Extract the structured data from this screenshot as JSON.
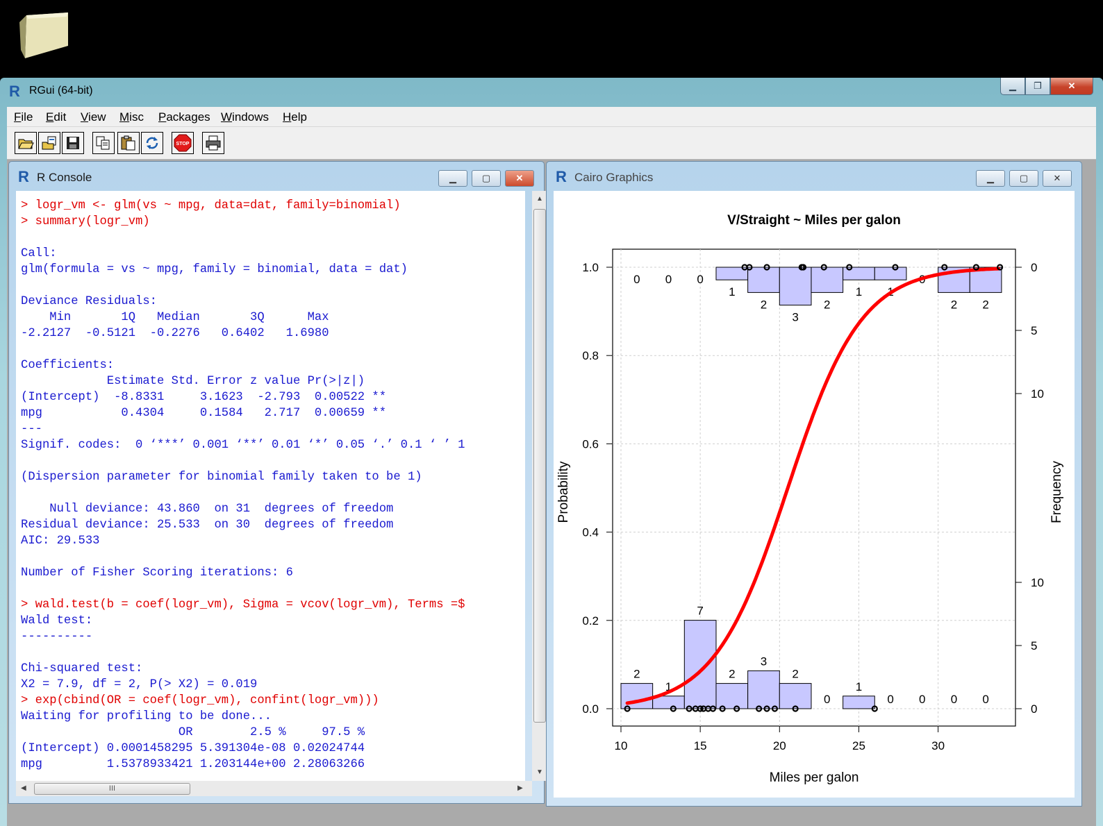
{
  "app": {
    "title": "RGui (64-bit)"
  },
  "menu": [
    {
      "label": "File",
      "key": "F",
      "rest": "ile"
    },
    {
      "label": "Edit",
      "key": "E",
      "rest": "dit"
    },
    {
      "label": "View",
      "key": "V",
      "rest": "iew"
    },
    {
      "label": "Misc",
      "key": "M",
      "rest": "isc"
    },
    {
      "label": "Packages",
      "key": "P",
      "rest": "ackages"
    },
    {
      "label": "Windows",
      "key": "W",
      "rest": "indows"
    },
    {
      "label": "Help",
      "key": "H",
      "rest": "elp"
    }
  ],
  "toolbar": [
    "open-script-icon",
    "load-workspace-icon",
    "save-workspace-icon",
    "copy-icon",
    "paste-icon",
    "refresh-icon",
    "stop-icon",
    "print-icon"
  ],
  "console": {
    "title": "R Console",
    "lines": [
      {
        "t": "> logr_vm <- glm(vs ~ mpg, data=dat, family=binomial)",
        "in": true
      },
      {
        "t": "> summary(logr_vm)",
        "in": true
      },
      {
        "t": "",
        "in": false
      },
      {
        "t": "Call:",
        "in": false
      },
      {
        "t": "glm(formula = vs ~ mpg, family = binomial, data = dat)",
        "in": false
      },
      {
        "t": "",
        "in": false
      },
      {
        "t": "Deviance Residuals:",
        "in": false
      },
      {
        "t": "    Min       1Q   Median       3Q      Max",
        "in": false
      },
      {
        "t": "-2.2127  -0.5121  -0.2276   0.6402   1.6980",
        "in": false
      },
      {
        "t": "",
        "in": false
      },
      {
        "t": "Coefficients:",
        "in": false
      },
      {
        "t": "            Estimate Std. Error z value Pr(>|z|)",
        "in": false
      },
      {
        "t": "(Intercept)  -8.8331     3.1623  -2.793  0.00522 **",
        "in": false
      },
      {
        "t": "mpg           0.4304     0.1584   2.717  0.00659 **",
        "in": false
      },
      {
        "t": "---",
        "in": false
      },
      {
        "t": "Signif. codes:  0 ‘***’ 0.001 ‘**’ 0.01 ‘*’ 0.05 ‘.’ 0.1 ‘ ’ 1",
        "in": false
      },
      {
        "t": "",
        "in": false
      },
      {
        "t": "(Dispersion parameter for binomial family taken to be 1)",
        "in": false
      },
      {
        "t": "",
        "in": false
      },
      {
        "t": "    Null deviance: 43.860  on 31  degrees of freedom",
        "in": false
      },
      {
        "t": "Residual deviance: 25.533  on 30  degrees of freedom",
        "in": false
      },
      {
        "t": "AIC: 29.533",
        "in": false
      },
      {
        "t": "",
        "in": false
      },
      {
        "t": "Number of Fisher Scoring iterations: 6",
        "in": false
      },
      {
        "t": "",
        "in": false
      },
      {
        "t": "> wald.test(b = coef(logr_vm), Sigma = vcov(logr_vm), Terms =$",
        "in": true
      },
      {
        "t": "Wald test:",
        "in": false
      },
      {
        "t": "----------",
        "in": false
      },
      {
        "t": "",
        "in": false
      },
      {
        "t": "Chi-squared test:",
        "in": false
      },
      {
        "t": "X2 = 7.9, df = 2, P(> X2) = 0.019",
        "in": false
      },
      {
        "t": "> exp(cbind(OR = coef(logr_vm), confint(logr_vm)))",
        "in": true
      },
      {
        "t": "Waiting for profiling to be done...",
        "in": false
      },
      {
        "t": "                      OR        2.5 %     97.5 %",
        "in": false
      },
      {
        "t": "(Intercept) 0.0001458295 5.391304e-08 0.02024744",
        "in": false
      },
      {
        "t": "mpg         1.5378933421 1.203144e+00 2.28063266",
        "in": false
      }
    ]
  },
  "graphics": {
    "title": "Cairo Graphics"
  },
  "chart_data": {
    "type": "logistic regression curve with marginal histograms",
    "title": "V/Straight ~ Miles per galon",
    "xlabel": "Miles per galon",
    "ylabel": "Probability",
    "y2label": "Frequency",
    "xlim": [
      10,
      34
    ],
    "ylim": [
      0,
      1
    ],
    "xticks": [
      10,
      15,
      20,
      25,
      30
    ],
    "yticks": [
      "0.0",
      "0.2",
      "0.4",
      "0.6",
      "0.8",
      "1.0"
    ],
    "y2ticks_top": [
      0,
      5,
      10
    ],
    "y2ticks_bottom": [
      0,
      5,
      10
    ],
    "grid": true,
    "bin_edges": [
      10,
      12,
      14,
      16,
      18,
      20,
      22,
      24,
      26,
      28,
      30,
      32,
      34
    ],
    "hist_vs1_counts": [
      0,
      0,
      0,
      1,
      2,
      3,
      2,
      1,
      1,
      0,
      2,
      2
    ],
    "hist_vs0_counts": [
      2,
      1,
      7,
      2,
      3,
      2,
      0,
      1,
      0,
      0,
      0,
      0
    ],
    "points_vs1": [
      17.8,
      18.1,
      19.2,
      21.4,
      21.5,
      22.8,
      24.4,
      27.3,
      30.4,
      32.4,
      33.9
    ],
    "points_vs0": [
      10.4,
      13.3,
      14.3,
      14.7,
      15.0,
      15.2,
      15.5,
      15.8,
      16.4,
      17.3,
      18.7,
      19.2,
      19.7,
      21.0,
      26.0
    ],
    "curve": {
      "intercept": -8.8331,
      "slope": 0.4304,
      "color": "#ff0000"
    },
    "bar_fill": "#c8c8ff"
  }
}
